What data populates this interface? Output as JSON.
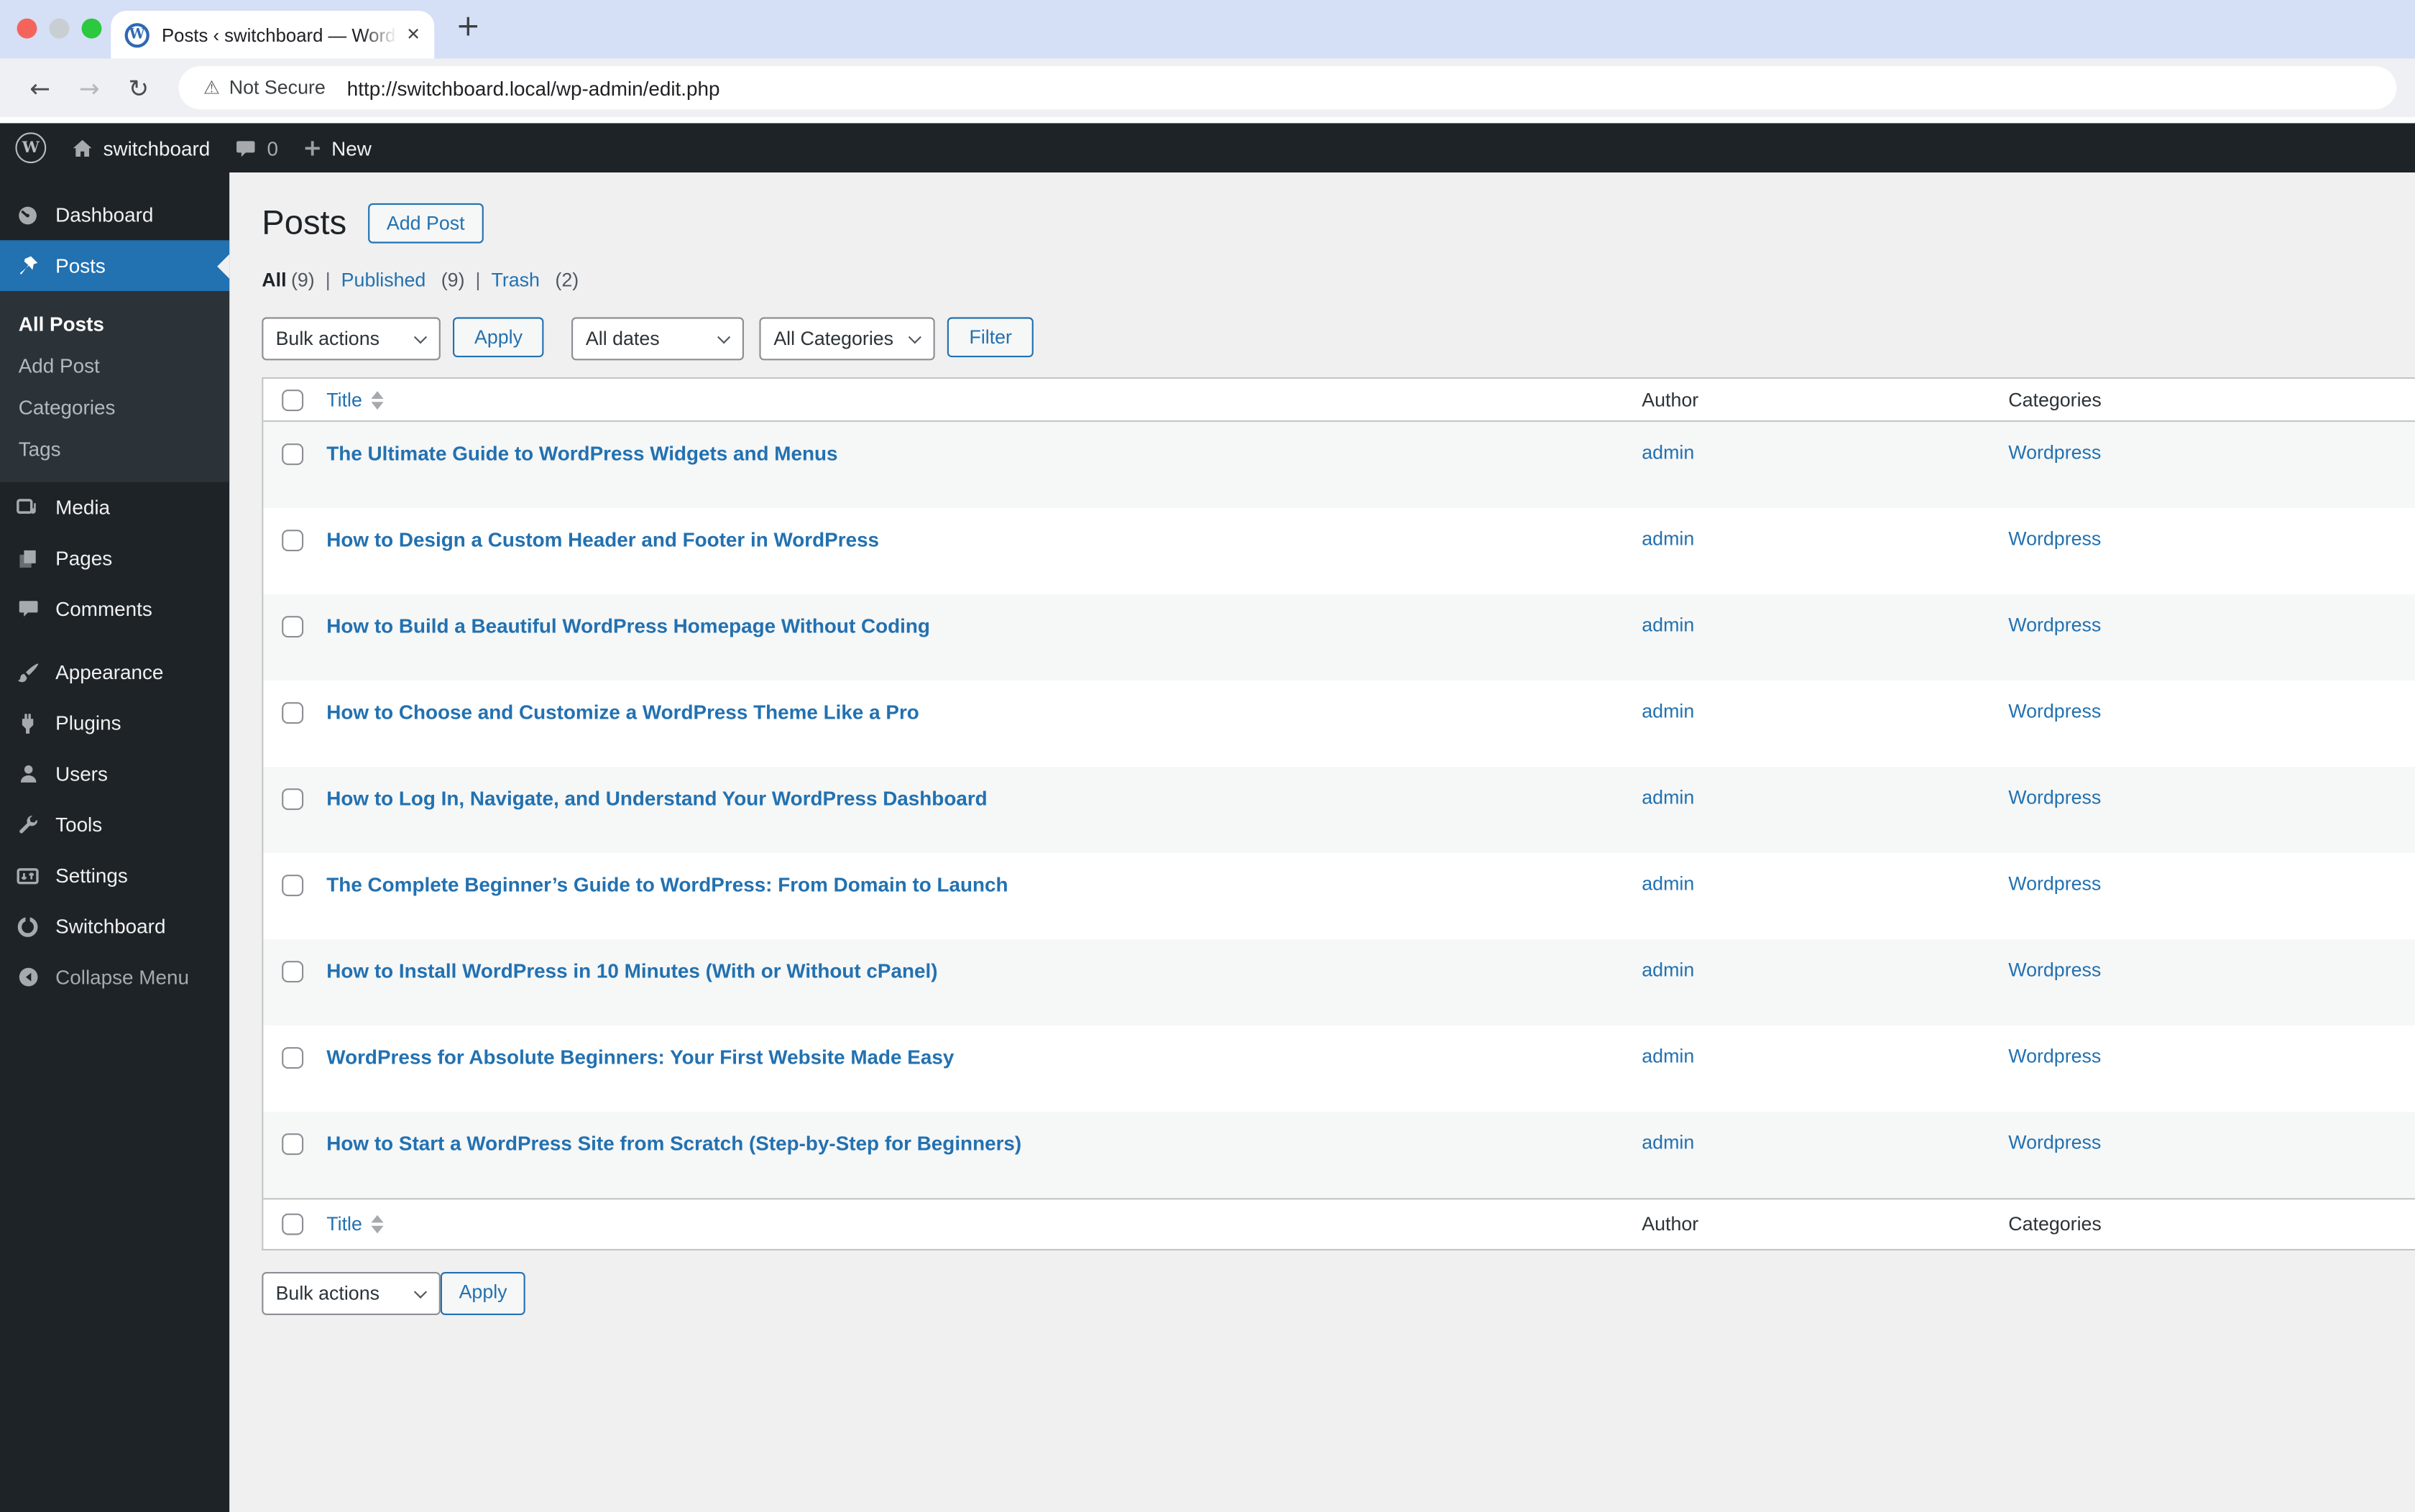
{
  "browser": {
    "tab_title": "Posts ‹ switchboard — WordP",
    "favicon_letter": "W",
    "close_glyph": "✕",
    "new_tab_glyph": "+",
    "back_glyph": "←",
    "forward_glyph": "→",
    "reload_glyph": "↻",
    "warning_glyph": "⚠",
    "security_label": "Not Secure",
    "url": "http://switchboard.local/wp-admin/edit.php"
  },
  "admin_bar": {
    "logo_letter": "W",
    "site_name": "switchboard",
    "comment_count": "0",
    "plus_glyph": "+",
    "new_label": "New"
  },
  "sidebar": {
    "items": [
      {
        "label": "Dashboard"
      },
      {
        "label": "Posts"
      },
      {
        "label": "Media"
      },
      {
        "label": "Pages"
      },
      {
        "label": "Comments"
      },
      {
        "label": "Appearance"
      },
      {
        "label": "Plugins"
      },
      {
        "label": "Users"
      },
      {
        "label": "Tools"
      },
      {
        "label": "Settings"
      },
      {
        "label": "Switchboard"
      }
    ],
    "posts_submenu": [
      {
        "label": "All Posts"
      },
      {
        "label": "Add Post"
      },
      {
        "label": "Categories"
      },
      {
        "label": "Tags"
      }
    ],
    "collapse_label": "Collapse Menu"
  },
  "page": {
    "title": "Posts",
    "add_post_button": "Add Post",
    "views": [
      {
        "label": "All",
        "count": "(9)"
      },
      {
        "label": "Published",
        "count": "(9)"
      },
      {
        "label": "Trash",
        "count": "(2)"
      }
    ],
    "view_separator": "|",
    "bulk_actions": "Bulk actions",
    "apply": "Apply",
    "all_dates": "All dates",
    "all_categories": "All Categories",
    "filter": "Filter"
  },
  "table": {
    "columns": {
      "title": "Title",
      "author": "Author",
      "categories": "Categories"
    },
    "rows": [
      {
        "title": "The Ultimate Guide to WordPress Widgets and Menus",
        "author": "admin",
        "category": "Wordpress"
      },
      {
        "title": "How to Design a Custom Header and Footer in WordPress",
        "author": "admin",
        "category": "Wordpress"
      },
      {
        "title": "How to Build a Beautiful WordPress Homepage Without Coding",
        "author": "admin",
        "category": "Wordpress"
      },
      {
        "title": "How to Choose and Customize a WordPress Theme Like a Pro",
        "author": "admin",
        "category": "Wordpress"
      },
      {
        "title": "How to Log In, Navigate, and Understand Your WordPress Dashboard",
        "author": "admin",
        "category": "Wordpress"
      },
      {
        "title": "The Complete Beginner’s Guide to WordPress: From Domain to Launch",
        "author": "admin",
        "category": "Wordpress"
      },
      {
        "title": "How to Install WordPress in 10 Minutes (With or Without cPanel)",
        "author": "admin",
        "category": "Wordpress"
      },
      {
        "title": "WordPress for Absolute Beginners: Your First Website Made Easy",
        "author": "admin",
        "category": "Wordpress"
      },
      {
        "title": "How to Start a WordPress Site from Scratch (Step-by-Step for Beginners)",
        "author": "admin",
        "category": "Wordpress"
      }
    ]
  },
  "colors": {
    "wp_link_blue": "#2271b1",
    "admin_bar_bg": "#1d2327",
    "submenu_bg": "#2c3338",
    "content_bg": "#f0f0f1",
    "table_border": "#c3c4c7",
    "row_stripe": "#f6f7f7",
    "tabstrip_bg": "#d5dff6",
    "traffic_red": "#f4645c",
    "traffic_middle": "#c9ced3",
    "traffic_green": "#2bc840"
  }
}
